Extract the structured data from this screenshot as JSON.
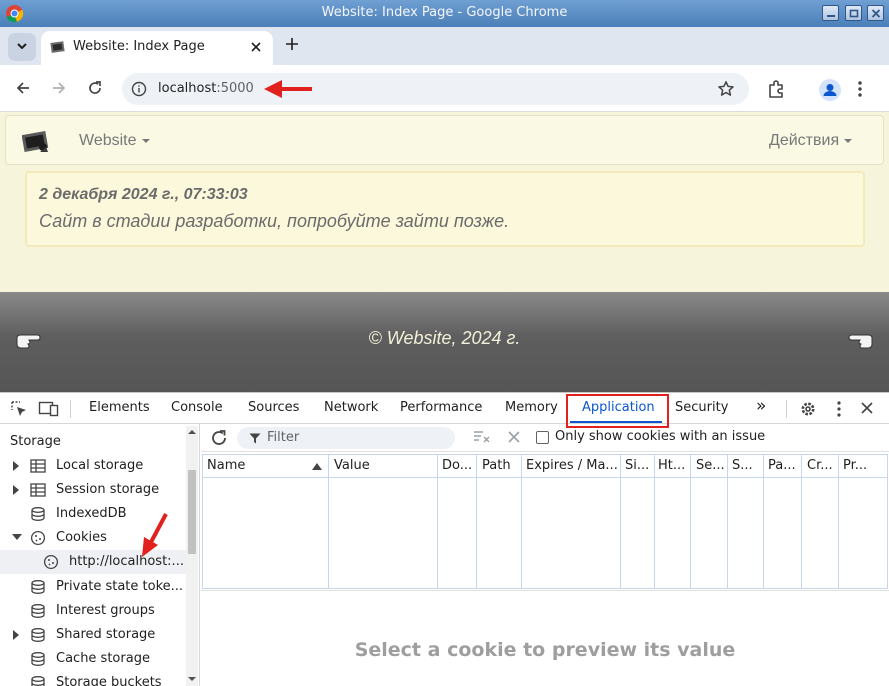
{
  "window": {
    "title": "Website: Index Page - Google Chrome"
  },
  "tab": {
    "title": "Website: Index Page"
  },
  "omnibox": {
    "host": "localhost",
    "port": ":5000"
  },
  "site": {
    "brand_menu": "Website",
    "actions_menu": "Действия",
    "alert_date": "2 декабря 2024 г., 07:33:03",
    "alert_message": "Сайт в стадии разработки, попробуйте зайти позже.",
    "footer": "© Website, 2024 г."
  },
  "devtools": {
    "tabs": [
      "Elements",
      "Console",
      "Sources",
      "Network",
      "Performance",
      "Memory",
      "Application",
      "Security"
    ],
    "active_tab": "Application",
    "more_tabs": "»",
    "sidebar": {
      "section": "Storage",
      "items": [
        {
          "label": "Local storage",
          "icon": "table-icon",
          "expandable": true
        },
        {
          "label": "Session storage",
          "icon": "table-icon",
          "expandable": true
        },
        {
          "label": "IndexedDB",
          "icon": "database-icon",
          "expandable": false
        },
        {
          "label": "Cookies",
          "icon": "cookie-icon",
          "expanded": true
        },
        {
          "label": "http://localhost:...",
          "icon": "cookie-icon",
          "selected": true
        },
        {
          "label": "Private state toke...",
          "icon": "database-icon",
          "expandable": false
        },
        {
          "label": "Interest groups",
          "icon": "database-icon",
          "expandable": false
        },
        {
          "label": "Shared storage",
          "icon": "database-icon",
          "expandable": true
        },
        {
          "label": "Cache storage",
          "icon": "database-icon",
          "expandable": false
        },
        {
          "label": "Storage buckets",
          "icon": "database-icon",
          "expandable": false
        }
      ]
    },
    "cookies": {
      "filter_placeholder": "Filter",
      "only_issues_label": "Only show cookies with an issue",
      "only_issues_checked": false,
      "columns": [
        "Name",
        "Value",
        "Do...",
        "Path",
        "Expires / Ma...",
        "Si...",
        "Ht...",
        "Se...",
        "S...",
        "Pa...",
        "Cr...",
        "Pr..."
      ],
      "sorted_column": "Name",
      "empty_preview": "Select a cookie to preview its value"
    }
  },
  "colors": {
    "accent": "#0b57d0",
    "annotation_red": "#e0211d",
    "page_bg": "#f6f5dc"
  }
}
